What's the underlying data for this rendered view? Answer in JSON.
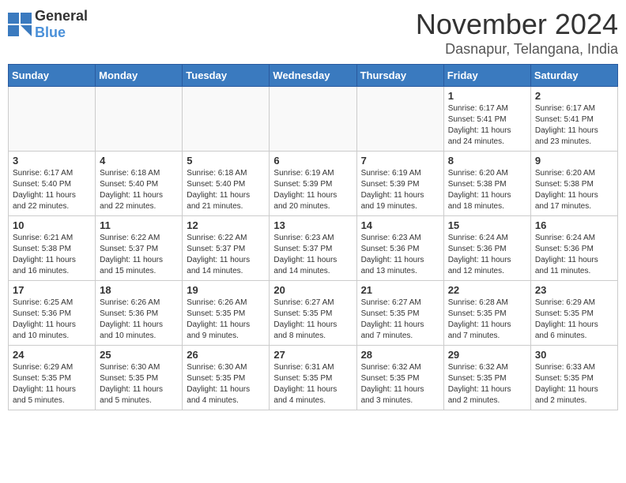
{
  "logo": {
    "general": "General",
    "blue": "Blue"
  },
  "header": {
    "month": "November 2024",
    "location": "Dasnapur, Telangana, India"
  },
  "days_of_week": [
    "Sunday",
    "Monday",
    "Tuesday",
    "Wednesday",
    "Thursday",
    "Friday",
    "Saturday"
  ],
  "weeks": [
    [
      {
        "day": "",
        "info": ""
      },
      {
        "day": "",
        "info": ""
      },
      {
        "day": "",
        "info": ""
      },
      {
        "day": "",
        "info": ""
      },
      {
        "day": "",
        "info": ""
      },
      {
        "day": "1",
        "info": "Sunrise: 6:17 AM\nSunset: 5:41 PM\nDaylight: 11 hours and 24 minutes."
      },
      {
        "day": "2",
        "info": "Sunrise: 6:17 AM\nSunset: 5:41 PM\nDaylight: 11 hours and 23 minutes."
      }
    ],
    [
      {
        "day": "3",
        "info": "Sunrise: 6:17 AM\nSunset: 5:40 PM\nDaylight: 11 hours and 22 minutes."
      },
      {
        "day": "4",
        "info": "Sunrise: 6:18 AM\nSunset: 5:40 PM\nDaylight: 11 hours and 22 minutes."
      },
      {
        "day": "5",
        "info": "Sunrise: 6:18 AM\nSunset: 5:40 PM\nDaylight: 11 hours and 21 minutes."
      },
      {
        "day": "6",
        "info": "Sunrise: 6:19 AM\nSunset: 5:39 PM\nDaylight: 11 hours and 20 minutes."
      },
      {
        "day": "7",
        "info": "Sunrise: 6:19 AM\nSunset: 5:39 PM\nDaylight: 11 hours and 19 minutes."
      },
      {
        "day": "8",
        "info": "Sunrise: 6:20 AM\nSunset: 5:38 PM\nDaylight: 11 hours and 18 minutes."
      },
      {
        "day": "9",
        "info": "Sunrise: 6:20 AM\nSunset: 5:38 PM\nDaylight: 11 hours and 17 minutes."
      }
    ],
    [
      {
        "day": "10",
        "info": "Sunrise: 6:21 AM\nSunset: 5:38 PM\nDaylight: 11 hours and 16 minutes."
      },
      {
        "day": "11",
        "info": "Sunrise: 6:22 AM\nSunset: 5:37 PM\nDaylight: 11 hours and 15 minutes."
      },
      {
        "day": "12",
        "info": "Sunrise: 6:22 AM\nSunset: 5:37 PM\nDaylight: 11 hours and 14 minutes."
      },
      {
        "day": "13",
        "info": "Sunrise: 6:23 AM\nSunset: 5:37 PM\nDaylight: 11 hours and 14 minutes."
      },
      {
        "day": "14",
        "info": "Sunrise: 6:23 AM\nSunset: 5:36 PM\nDaylight: 11 hours and 13 minutes."
      },
      {
        "day": "15",
        "info": "Sunrise: 6:24 AM\nSunset: 5:36 PM\nDaylight: 11 hours and 12 minutes."
      },
      {
        "day": "16",
        "info": "Sunrise: 6:24 AM\nSunset: 5:36 PM\nDaylight: 11 hours and 11 minutes."
      }
    ],
    [
      {
        "day": "17",
        "info": "Sunrise: 6:25 AM\nSunset: 5:36 PM\nDaylight: 11 hours and 10 minutes."
      },
      {
        "day": "18",
        "info": "Sunrise: 6:26 AM\nSunset: 5:36 PM\nDaylight: 11 hours and 10 minutes."
      },
      {
        "day": "19",
        "info": "Sunrise: 6:26 AM\nSunset: 5:35 PM\nDaylight: 11 hours and 9 minutes."
      },
      {
        "day": "20",
        "info": "Sunrise: 6:27 AM\nSunset: 5:35 PM\nDaylight: 11 hours and 8 minutes."
      },
      {
        "day": "21",
        "info": "Sunrise: 6:27 AM\nSunset: 5:35 PM\nDaylight: 11 hours and 7 minutes."
      },
      {
        "day": "22",
        "info": "Sunrise: 6:28 AM\nSunset: 5:35 PM\nDaylight: 11 hours and 7 minutes."
      },
      {
        "day": "23",
        "info": "Sunrise: 6:29 AM\nSunset: 5:35 PM\nDaylight: 11 hours and 6 minutes."
      }
    ],
    [
      {
        "day": "24",
        "info": "Sunrise: 6:29 AM\nSunset: 5:35 PM\nDaylight: 11 hours and 5 minutes."
      },
      {
        "day": "25",
        "info": "Sunrise: 6:30 AM\nSunset: 5:35 PM\nDaylight: 11 hours and 5 minutes."
      },
      {
        "day": "26",
        "info": "Sunrise: 6:30 AM\nSunset: 5:35 PM\nDaylight: 11 hours and 4 minutes."
      },
      {
        "day": "27",
        "info": "Sunrise: 6:31 AM\nSunset: 5:35 PM\nDaylight: 11 hours and 4 minutes."
      },
      {
        "day": "28",
        "info": "Sunrise: 6:32 AM\nSunset: 5:35 PM\nDaylight: 11 hours and 3 minutes."
      },
      {
        "day": "29",
        "info": "Sunrise: 6:32 AM\nSunset: 5:35 PM\nDaylight: 11 hours and 2 minutes."
      },
      {
        "day": "30",
        "info": "Sunrise: 6:33 AM\nSunset: 5:35 PM\nDaylight: 11 hours and 2 minutes."
      }
    ]
  ]
}
